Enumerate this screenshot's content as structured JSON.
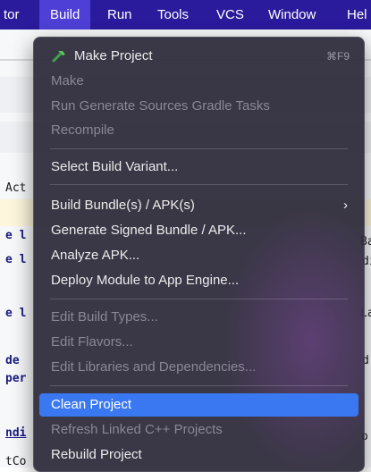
{
  "menubar": {
    "items": [
      {
        "label": "tor"
      },
      {
        "label": "Build"
      },
      {
        "label": "Run"
      },
      {
        "label": "Tools"
      },
      {
        "label": "VCS"
      },
      {
        "label": "Window"
      },
      {
        "label": "Hel"
      }
    ]
  },
  "editor": {
    "code_fragments": [
      {
        "text": "Act"
      },
      {
        "text": "e l"
      },
      {
        "text": "e l"
      },
      {
        "text": "e l"
      },
      {
        "text": "de"
      },
      {
        "text": "per"
      },
      {
        "text": "ndi"
      },
      {
        "text": "tCo"
      },
      {
        "text": "Ba"
      },
      {
        "text": "di"
      },
      {
        "text": "La"
      },
      {
        "text": "d"
      },
      {
        "text": "o"
      }
    ]
  },
  "build_menu": {
    "items": [
      {
        "label": "Make Project",
        "shortcut": "⌘F9",
        "icon": "hammer-icon",
        "enabled": true
      },
      {
        "label": "Make",
        "enabled": false
      },
      {
        "label": "Run Generate Sources Gradle Tasks",
        "enabled": false
      },
      {
        "label": "Recompile",
        "enabled": false
      },
      {
        "label": "Select Build Variant...",
        "enabled": true
      },
      {
        "label": "Build Bundle(s) / APK(s)",
        "enabled": true,
        "submenu": true,
        "chevron": "›"
      },
      {
        "label": "Generate Signed Bundle / APK...",
        "enabled": true
      },
      {
        "label": "Analyze APK...",
        "enabled": true
      },
      {
        "label": "Deploy Module to App Engine...",
        "enabled": true
      },
      {
        "label": "Edit Build Types...",
        "enabled": false
      },
      {
        "label": "Edit Flavors...",
        "enabled": false
      },
      {
        "label": "Edit Libraries and Dependencies...",
        "enabled": false
      },
      {
        "label": "Clean Project",
        "enabled": true,
        "selected": true
      },
      {
        "label": "Refresh Linked C++ Projects",
        "enabled": false
      },
      {
        "label": "Rebuild Project",
        "enabled": true
      }
    ]
  },
  "colors": {
    "menubar_bg": "#2a1a9c",
    "menubar_active": "#4e3fd6",
    "menu_bg": "#2e2a3a",
    "selection": "#3a78f2",
    "hammer_green": "#4caf50"
  }
}
